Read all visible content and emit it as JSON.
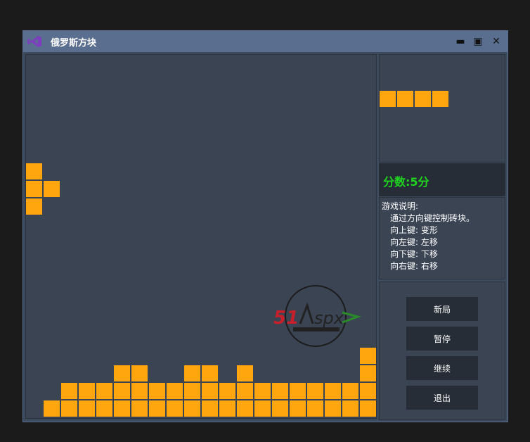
{
  "window": {
    "title": "俄罗斯方块",
    "minimize_glyph": "▬",
    "maximize_glyph": "▣",
    "close_glyph": "✕"
  },
  "icons": {
    "app": "visual-studio-icon",
    "watermark": "51aspx-logo"
  },
  "watermark_text": "51Aspx",
  "score": {
    "label": "分数:5分"
  },
  "instructions": {
    "title": "游戏说明:",
    "lines": [
      "通过方向键控制砖块。",
      "向上键: 变形",
      "向左键: 左移",
      "向下键: 下移",
      "向右键: 右移"
    ]
  },
  "buttons": {
    "new_game": "新局",
    "pause": "暂停",
    "resume": "继续",
    "exit": "退出"
  },
  "colors": {
    "block": "#ffa50d",
    "score": "#1fd31f",
    "titlebar": "#5a6f8f",
    "panel": "#3a4453"
  }
}
